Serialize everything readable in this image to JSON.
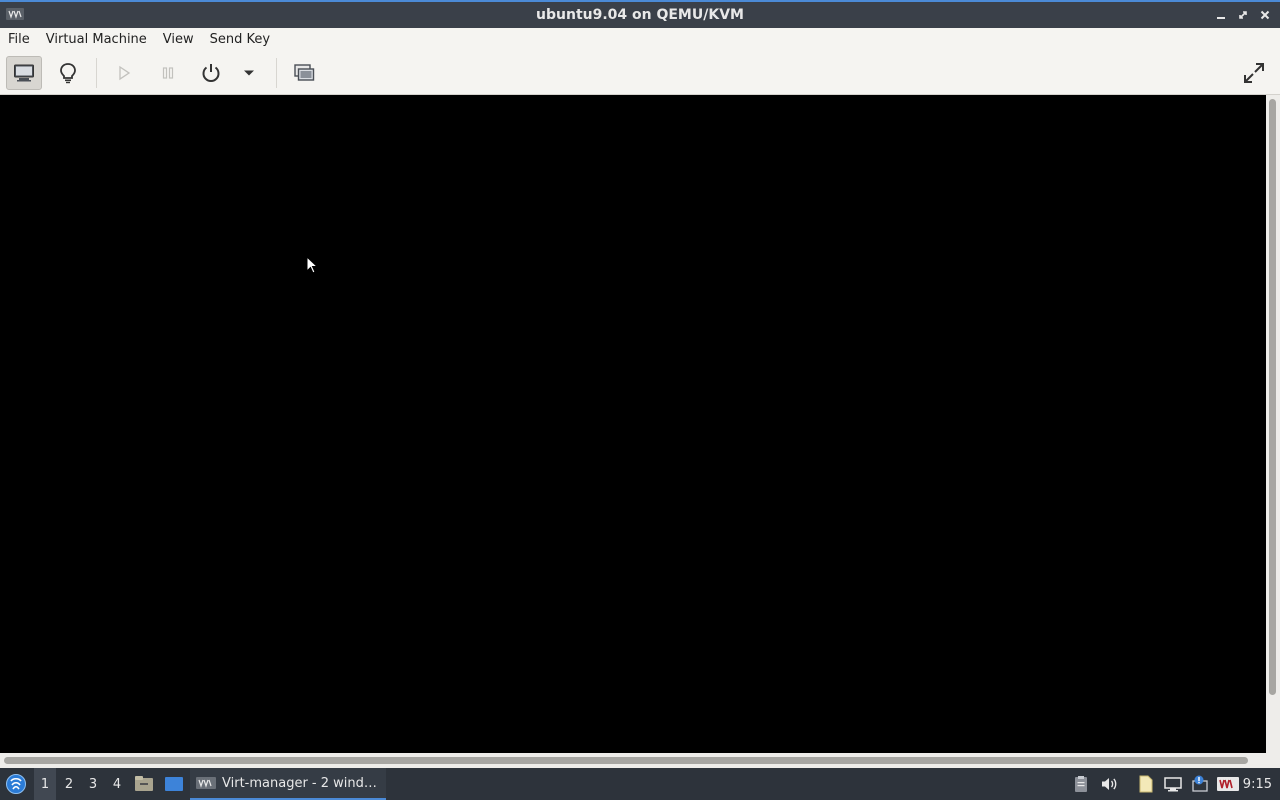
{
  "window": {
    "title": "ubuntu9.04 on QEMU/KVM",
    "app_icon": "virt-manager-icon",
    "controls": [
      "minimize-icon",
      "maximize-icon",
      "close-icon"
    ]
  },
  "menubar": {
    "items": [
      "File",
      "Virtual Machine",
      "View",
      "Send Key"
    ]
  },
  "toolbar": {
    "buttons": [
      "console-icon",
      "details-lightbulb-icon",
      "run-icon",
      "pause-icon",
      "power-icon",
      "dropdown-arrow-icon",
      "snapshots-icon",
      "fullscreen-icon"
    ]
  },
  "taskbar": {
    "workspaces": [
      "1",
      "2",
      "3",
      "4"
    ],
    "current_workspace": "1",
    "task_label": "Virt-manager - 2 wind…",
    "clock": "9:15",
    "tray_icons": [
      "clipboard-icon",
      "volume-icon",
      "files-icon",
      "network-icon",
      "notification-icon",
      "virt-manager-tray-icon"
    ]
  },
  "colors": {
    "accent": "#4b8ad6",
    "titlebar": "#3a4049",
    "taskbar": "#2d333b",
    "toolbar": "#f5f4f1",
    "console": "#000000"
  }
}
